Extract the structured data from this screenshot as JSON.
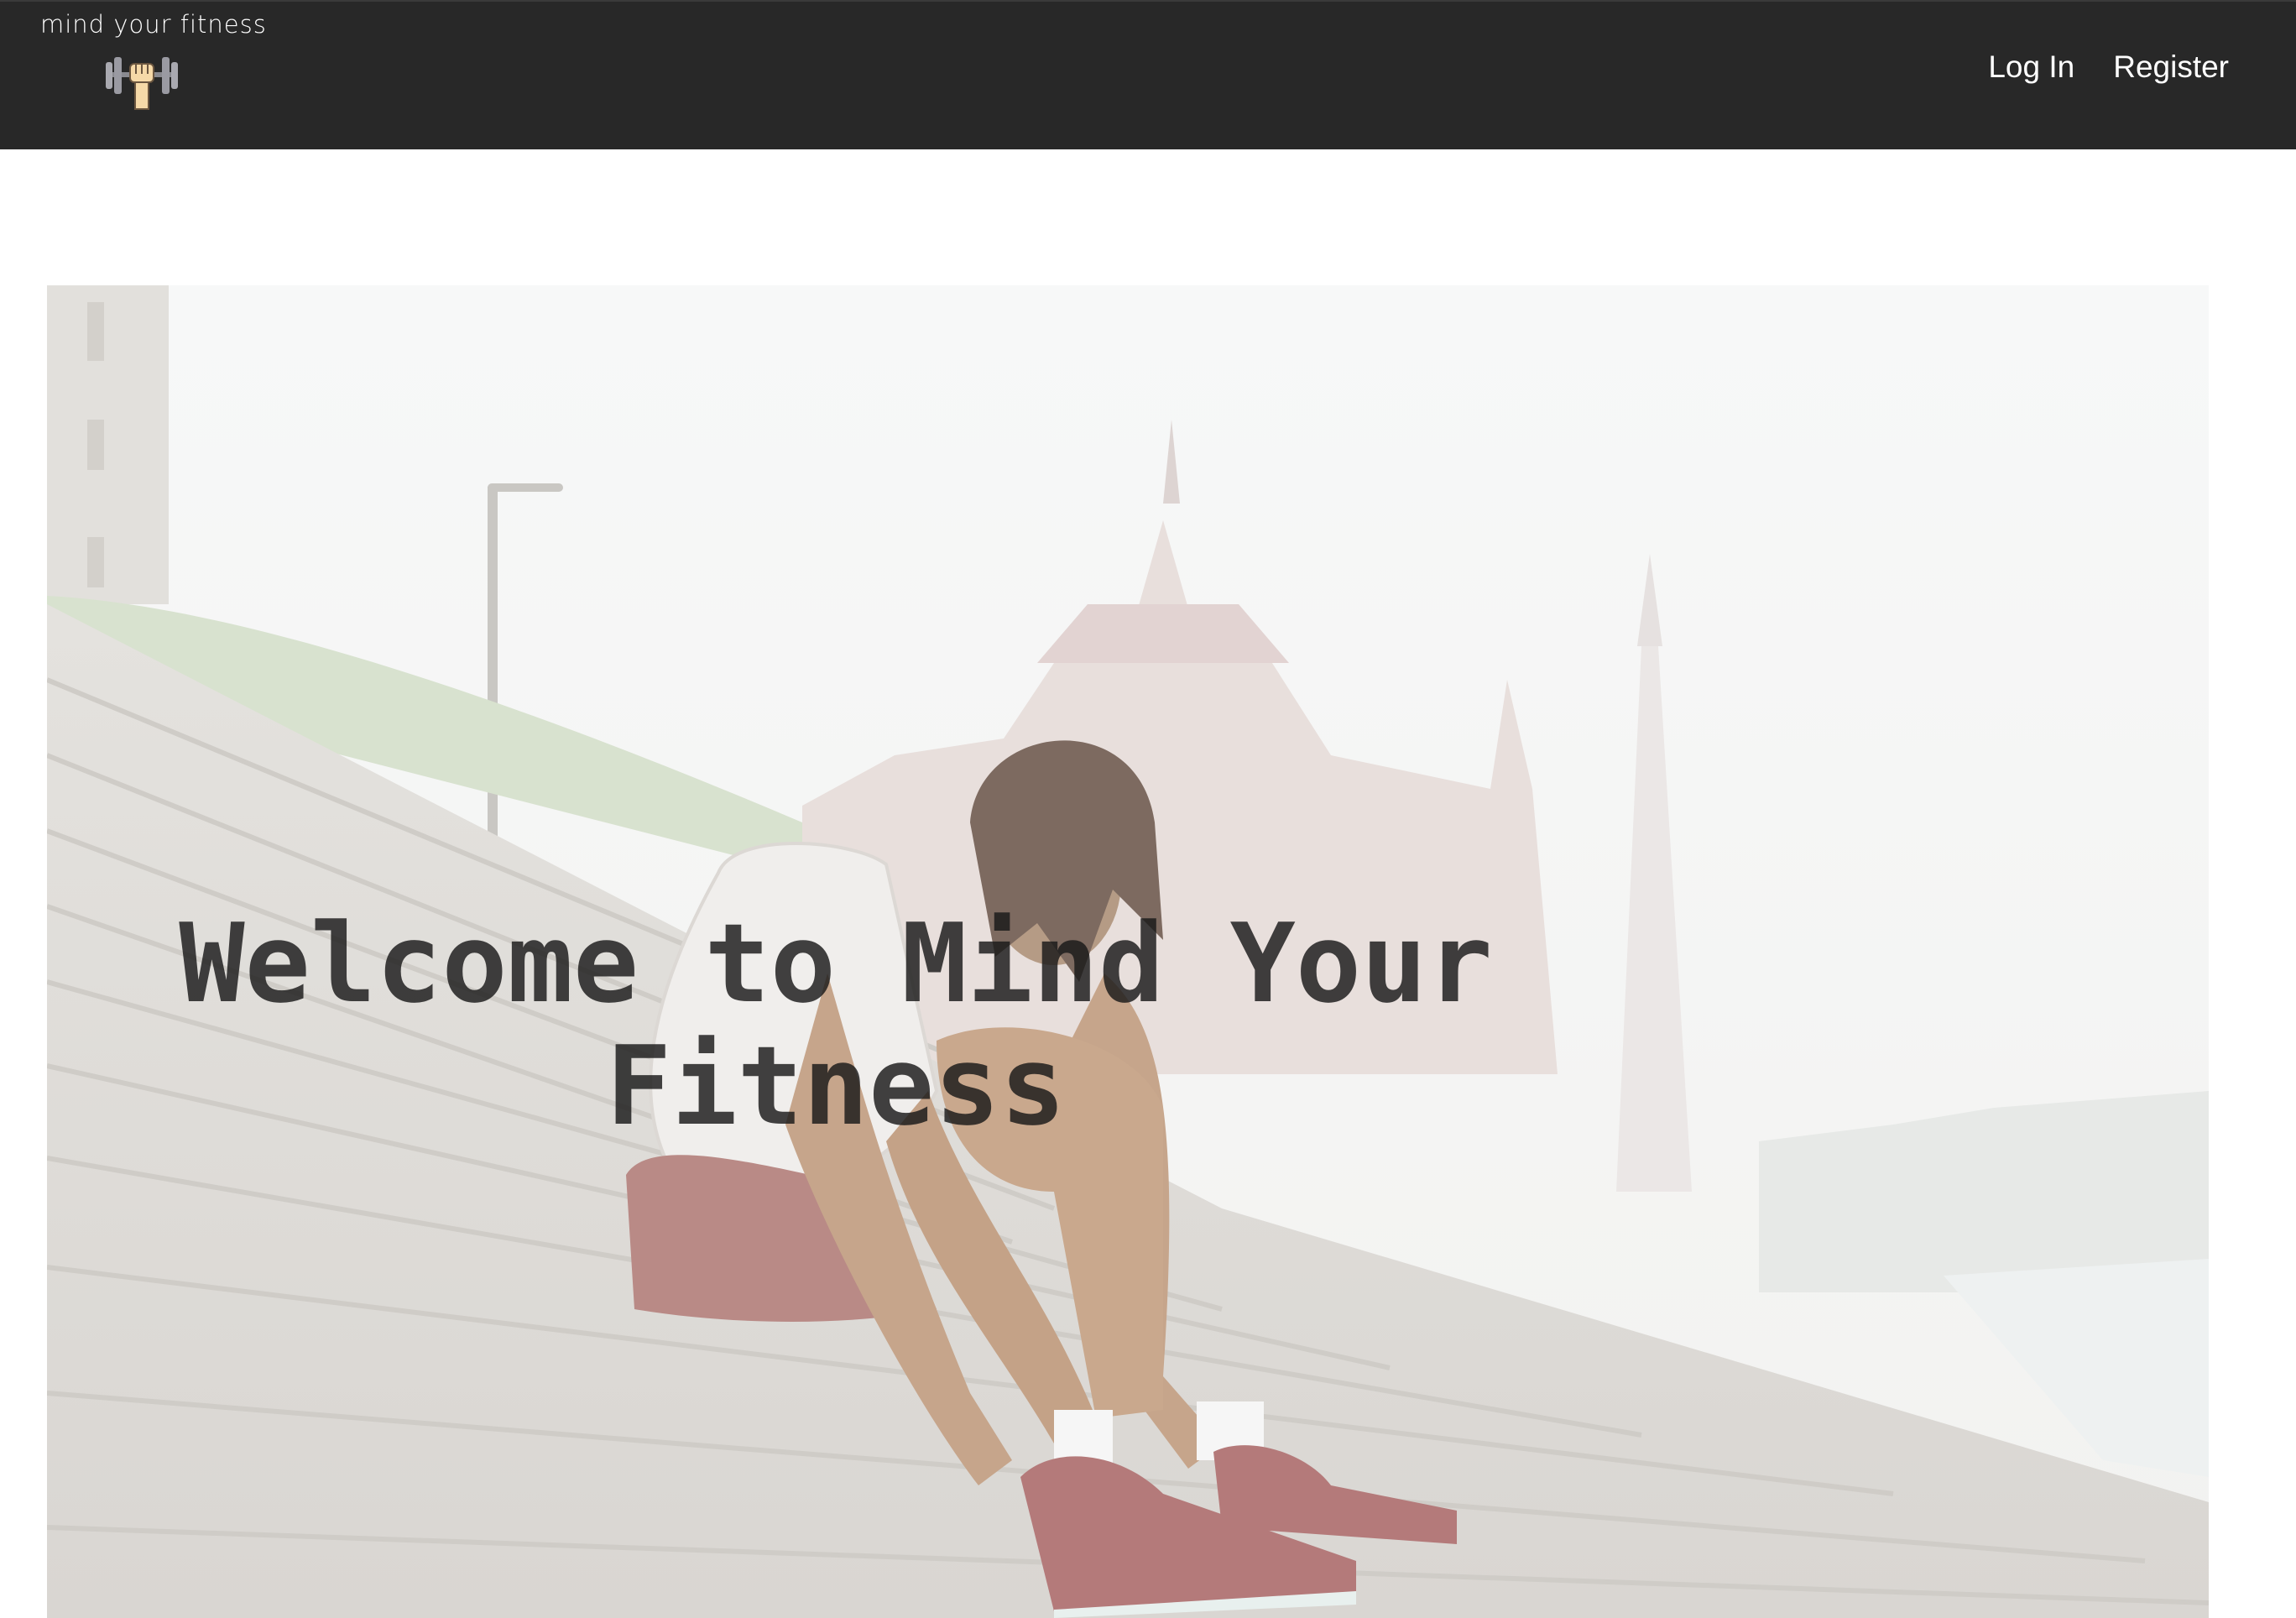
{
  "brand": {
    "name": "mind your fitness",
    "logo_icon": "dumbbell-fist-icon"
  },
  "nav": {
    "items": [
      {
        "label": "Log In",
        "name": "login-link"
      },
      {
        "label": "Register",
        "name": "register-link"
      }
    ]
  },
  "hero": {
    "title": "Welcome to Mind Your Fitness",
    "image_icon": "hero-photo-runner-on-steps"
  },
  "colors": {
    "navbar": "#282828",
    "nav_text": "#ffffff",
    "hero_title": "#191919",
    "page_bg": "#ffffff"
  }
}
